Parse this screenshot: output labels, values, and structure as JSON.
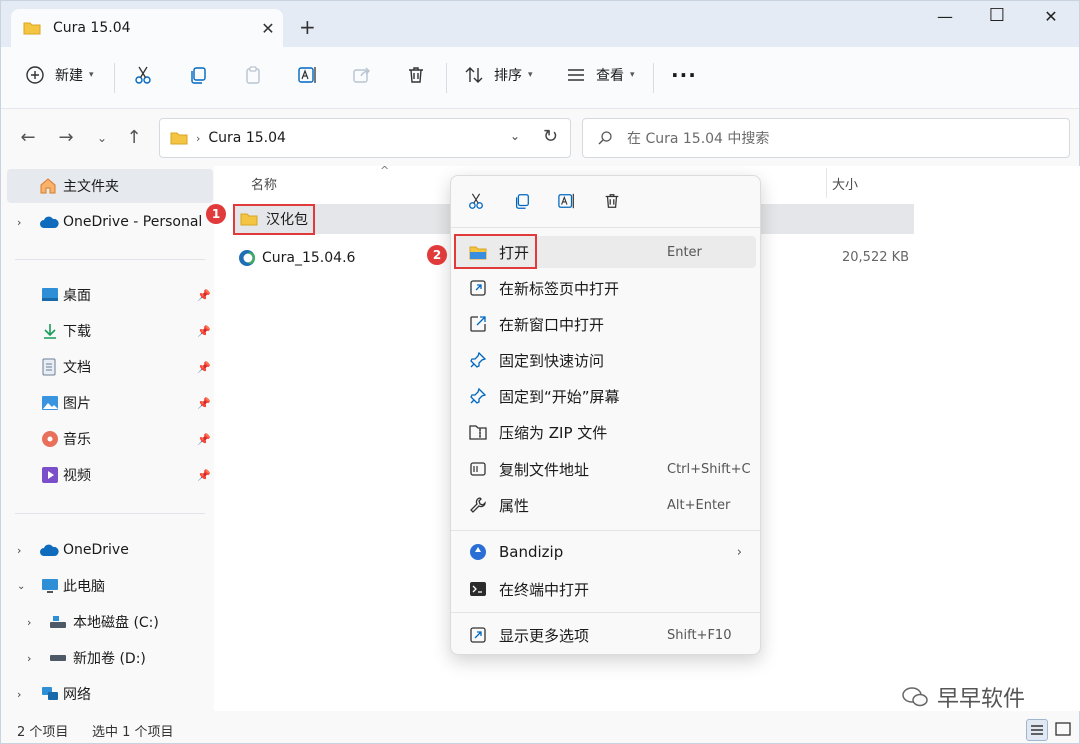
{
  "window": {
    "tab_title": "Cura 15.04",
    "tab_close": "✕",
    "new_tab": "+",
    "minimize": "—",
    "maximize": "☐",
    "close": "✕"
  },
  "toolbar": {
    "new_label": "新建",
    "sort_label": "排序",
    "view_label": "查看",
    "more": "···"
  },
  "address": {
    "path": "Cura 15.04",
    "search_placeholder": "在 Cura 15.04 中搜索"
  },
  "sidebar": {
    "home": "主文件夹",
    "onedrive_personal": "OneDrive - Personal",
    "quick": [
      {
        "label": "桌面"
      },
      {
        "label": "下载"
      },
      {
        "label": "文档"
      },
      {
        "label": "图片"
      },
      {
        "label": "音乐"
      },
      {
        "label": "视频"
      }
    ],
    "onedrive": "OneDrive",
    "this_pc": "此电脑",
    "drive_c": "本地磁盘 (C:)",
    "drive_d": "新加卷 (D:)",
    "network": "网络"
  },
  "columns": {
    "name": "名称",
    "size": "大小"
  },
  "files": [
    {
      "name": "汉化包",
      "size": ""
    },
    {
      "name": "Cura_15.04.6",
      "size": "20,522 KB"
    }
  ],
  "context_menu": {
    "items": [
      {
        "label": "打开",
        "shortcut": "Enter"
      },
      {
        "label": "在新标签页中打开",
        "shortcut": ""
      },
      {
        "label": "在新窗口中打开",
        "shortcut": ""
      },
      {
        "label": "固定到快速访问",
        "shortcut": ""
      },
      {
        "label": "固定到“开始”屏幕",
        "shortcut": ""
      },
      {
        "label": "压缩为 ZIP 文件",
        "shortcut": ""
      },
      {
        "label": "复制文件地址",
        "shortcut": "Ctrl+Shift+C"
      },
      {
        "label": "属性",
        "shortcut": "Alt+Enter"
      },
      {
        "label": "Bandizip",
        "shortcut": ""
      },
      {
        "label": "在终端中打开",
        "shortcut": ""
      },
      {
        "label": "显示更多选项",
        "shortcut": "Shift+F10"
      }
    ]
  },
  "annotations": {
    "badge1": "1",
    "badge2": "2"
  },
  "status": {
    "count": "2 个项目",
    "selected": "选中 1 个项目"
  },
  "watermark": "早早软件",
  "colors": {
    "accent": "#005fb8",
    "annotation_red": "#e03a3a",
    "folder_yellow": "#f4c542"
  }
}
